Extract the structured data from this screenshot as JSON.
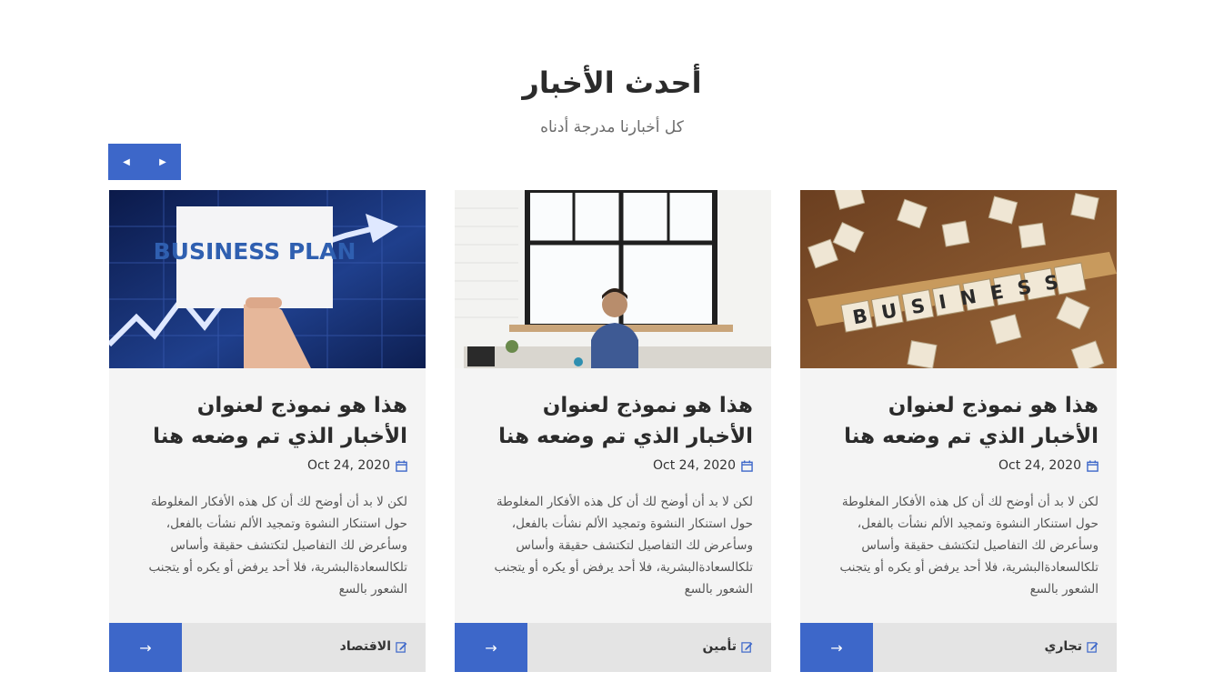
{
  "section": {
    "title": "أحدث الأخبار",
    "subtitle": "كل أخبارنا مدرجة أدناه"
  },
  "nav": {
    "prev_icon": "◀",
    "next_icon": "▶"
  },
  "colors": {
    "accent": "#3d67c9",
    "card_bg": "#f4f4f4",
    "footer_bg": "#e4e4e4"
  },
  "cards": [
    {
      "image_text": "BUSINESS",
      "title": "هذا هو نموذج لعنوان الأخبار الذي تم وضعه هنا",
      "date": "Oct 24, 2020",
      "text": "لكن لا بد أن أوضح لك أن كل هذه الأفكار المغلوطة حول استنكار النشوة وتمجيد الألم نشأت بالفعل، وسأعرض لك التفاصيل لتكتشف حقيقة وأساس تلكالسعادةالبشرية، فلا أحد يرفض أو يكره أو يتجنب الشعور بالسع",
      "category": "تجاري",
      "arrow": "→"
    },
    {
      "image_text": "",
      "title": "هذا هو نموذج لعنوان الأخبار الذي تم وضعه هنا",
      "date": "Oct 24, 2020",
      "text": "لكن لا بد أن أوضح لك أن كل هذه الأفكار المغلوطة حول استنكار النشوة وتمجيد الألم نشأت بالفعل، وسأعرض لك التفاصيل لتكتشف حقيقة وأساس تلكالسعادةالبشرية، فلا أحد يرفض أو يكره أو يتجنب الشعور بالسع",
      "category": "تأمين",
      "arrow": "→"
    },
    {
      "image_text": "BUSINESS PLAN",
      "title": "هذا هو نموذج لعنوان الأخبار الذي تم وضعه هنا",
      "date": "Oct 24, 2020",
      "text": "لكن لا بد أن أوضح لك أن كل هذه الأفكار المغلوطة حول استنكار النشوة وتمجيد الألم نشأت بالفعل، وسأعرض لك التفاصيل لتكتشف حقيقة وأساس تلكالسعادةالبشرية، فلا أحد يرفض أو يكره أو يتجنب الشعور بالسع",
      "category": "الاقتصاد",
      "arrow": "→"
    }
  ]
}
